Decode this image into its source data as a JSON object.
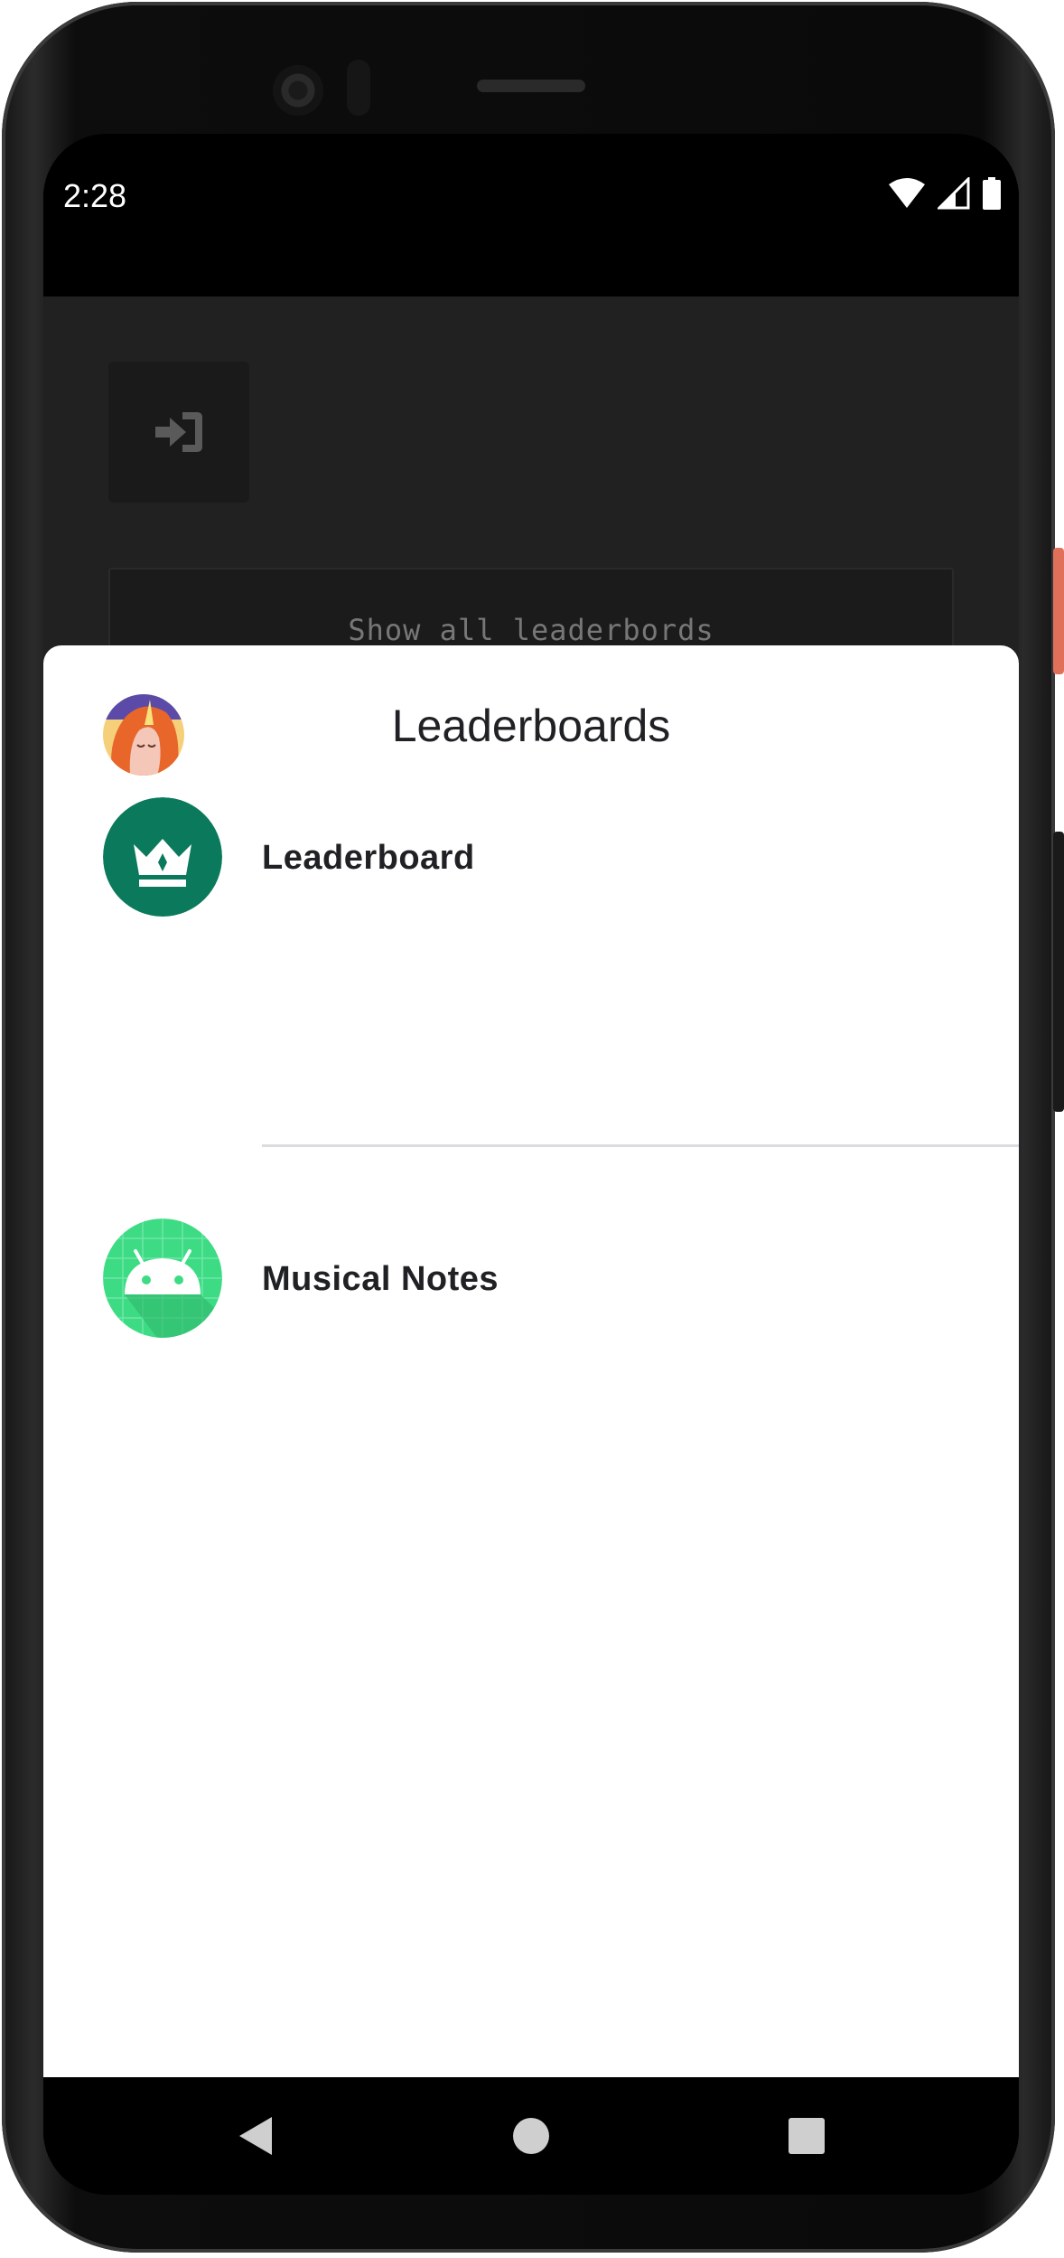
{
  "status_bar": {
    "time": "2:28",
    "icons": [
      "wifi-icon",
      "signal-icon",
      "battery-icon"
    ]
  },
  "app": {
    "back_icon": "sign-in-icon",
    "show_all_button": "Show all leaderbords"
  },
  "sheet": {
    "title": "Leaderboards",
    "avatar_icon": "unicorn-avatar",
    "items": [
      {
        "label": "Leaderboard",
        "icon": "crown-icon",
        "color": "#0b7a5c"
      },
      {
        "label": "Musical Notes",
        "icon": "android-icon",
        "color": "#3ddc84"
      }
    ]
  },
  "nav": {
    "back": "back-triangle-icon",
    "home": "home-circle-icon",
    "recents": "recents-square-icon"
  },
  "colors": {
    "sheet_bg": "#ffffff",
    "app_bg": "#212121",
    "accent_power_button": "#e0705a"
  }
}
